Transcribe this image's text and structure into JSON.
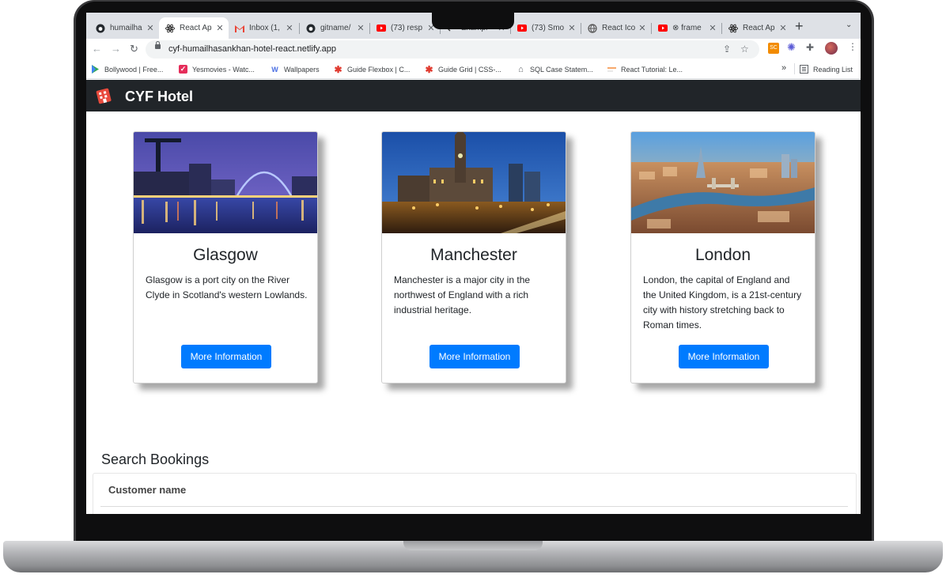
{
  "browser": {
    "tabs": [
      {
        "title": "humailha",
        "icon": "github-icon",
        "active": false
      },
      {
        "title": "React Ap",
        "icon": "react-icon",
        "active": true
      },
      {
        "title": "Inbox (1,",
        "icon": "gmail-icon",
        "active": false
      },
      {
        "title": "gitname/",
        "icon": "github-icon",
        "active": false
      },
      {
        "title": "(73) resp",
        "icon": "youtube-icon",
        "active": false
      },
      {
        "title": "Exampl",
        "icon": "code-icon",
        "active": false
      },
      {
        "title": "(73) Smo",
        "icon": "youtube-icon",
        "active": false
      },
      {
        "title": "React Ico",
        "icon": "globe-icon",
        "active": false
      },
      {
        "title": "⊗ frame",
        "icon": "youtube-icon",
        "active": false
      },
      {
        "title": "React Ap",
        "icon": "react-icon",
        "active": false
      }
    ],
    "new_tab": "+",
    "url": "cyf-humailhasankhan-hotel-react.netlify.app",
    "bookmarks": [
      {
        "label": "Bollywood | Free...",
        "icon": "play-icon"
      },
      {
        "label": "Yesmovies - Watc...",
        "icon": "yesmovies-icon"
      },
      {
        "label": "Wallpapers",
        "icon": "wallpapers-icon"
      },
      {
        "label": "Guide Flexbox | C...",
        "icon": "asterisk-icon"
      },
      {
        "label": "Guide Grid | CSS-...",
        "icon": "asterisk-icon"
      },
      {
        "label": "SQL Case Statem...",
        "icon": "home-icon"
      },
      {
        "label": "React Tutorial: Le...",
        "icon": "react-tutorial-icon"
      }
    ],
    "bookmarks_overflow": "»",
    "reading_list": "Reading List",
    "extension_sc": "SC"
  },
  "app": {
    "brand": "CYF Hotel"
  },
  "cities": [
    {
      "name": "Glasgow",
      "description": "Glasgow is a port city on the River Clyde in Scotland's western Lowlands.",
      "button": "More Information"
    },
    {
      "name": "Manchester",
      "description": "Manchester is a major city in the northwest of England with a rich industrial heritage.",
      "button": "More Information"
    },
    {
      "name": "London",
      "description": "London, the capital of England and the United Kingdom, is a 21st-century city with history stretching back to Roman times.",
      "button": "More Information"
    }
  ],
  "search": {
    "heading": "Search Bookings",
    "customer_label": "Customer name"
  },
  "colors": {
    "navbar": "#212529",
    "button": "#007bff",
    "laptop_frame": "#0e0e0f"
  }
}
